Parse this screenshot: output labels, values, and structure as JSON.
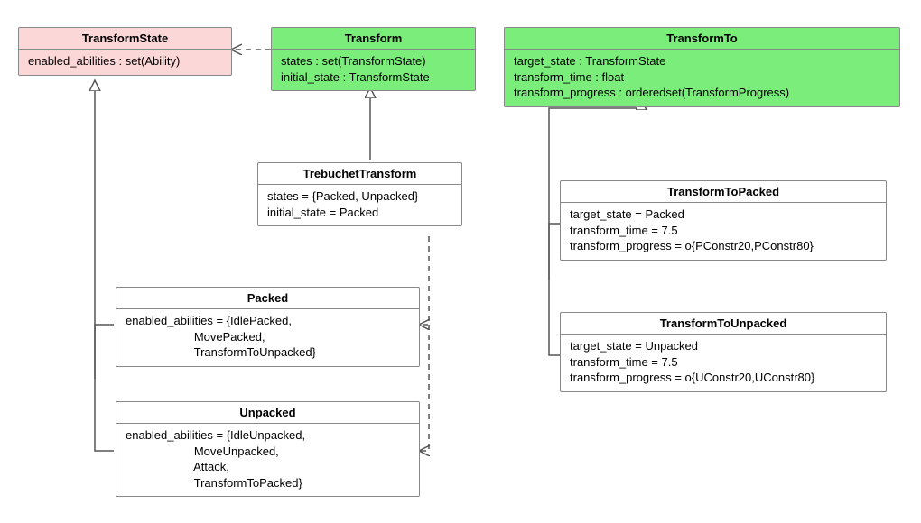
{
  "classes": {
    "transformState": {
      "title": "TransformState",
      "body": "enabled_abilities : set(Ability)"
    },
    "transform": {
      "title": "Transform",
      "body": "states : set(TransformState)\ninitial_state : TransformState"
    },
    "transformTo": {
      "title": "TransformTo",
      "body": "target_state : TransformState\ntransform_time : float\ntransform_progress : orderedset(TransformProgress)"
    },
    "trebuchetTransform": {
      "title": "TrebuchetTransform",
      "body": "states = {Packed, Unpacked}\ninitial_state = Packed"
    },
    "transformToPacked": {
      "title": "TransformToPacked",
      "body": "target_state = Packed\ntransform_time = 7.5\ntransform_progress = o{PConstr20,PConstr80}"
    },
    "transformToUnpacked": {
      "title": "TransformToUnpacked",
      "body": "target_state = Unpacked\ntransform_time = 7.5\ntransform_progress = o{UConstr20,UConstr80}"
    },
    "packed": {
      "title": "Packed",
      "body": "enabled_abilities = {IdlePacked,\n                     MovePacked,\n                     TransformToUnpacked}"
    },
    "unpacked": {
      "title": "Unpacked",
      "body": "enabled_abilities = {IdleUnpacked,\n                     MoveUnpacked,\n                     Attack,\n                     TransformToPacked}"
    }
  },
  "chart_data": {
    "type": "uml-class-diagram",
    "classes": [
      {
        "name": "TransformState",
        "stereotype": "base",
        "color": "pink",
        "attributes": [
          "enabled_abilities : set(Ability)"
        ]
      },
      {
        "name": "Transform",
        "stereotype": "base",
        "color": "green",
        "attributes": [
          "states : set(TransformState)",
          "initial_state : TransformState"
        ]
      },
      {
        "name": "TransformTo",
        "stereotype": "base",
        "color": "green",
        "attributes": [
          "target_state : TransformState",
          "transform_time : float",
          "transform_progress : orderedset(TransformProgress)"
        ]
      },
      {
        "name": "TrebuchetTransform",
        "attributes": [
          "states = {Packed, Unpacked}",
          "initial_state = Packed"
        ]
      },
      {
        "name": "TransformToPacked",
        "attributes": [
          "target_state = Packed",
          "transform_time = 7.5",
          "transform_progress = o{PConstr20,PConstr80}"
        ]
      },
      {
        "name": "TransformToUnpacked",
        "attributes": [
          "target_state = Unpacked",
          "transform_time = 7.5",
          "transform_progress = o{UConstr20,UConstr80}"
        ]
      },
      {
        "name": "Packed",
        "attributes": [
          "enabled_abilities = {IdlePacked, MovePacked, TransformToUnpacked}"
        ]
      },
      {
        "name": "Unpacked",
        "attributes": [
          "enabled_abilities = {IdleUnpacked, MoveUnpacked, Attack, TransformToPacked}"
        ]
      }
    ],
    "relations": [
      {
        "from": "TrebuchetTransform",
        "to": "Transform",
        "type": "generalization"
      },
      {
        "from": "TransformToPacked",
        "to": "TransformTo",
        "type": "generalization"
      },
      {
        "from": "TransformToUnpacked",
        "to": "TransformTo",
        "type": "generalization"
      },
      {
        "from": "Packed",
        "to": "TransformState",
        "type": "generalization"
      },
      {
        "from": "Unpacked",
        "to": "TransformState",
        "type": "generalization"
      },
      {
        "from": "Transform",
        "to": "TransformState",
        "type": "dependency"
      },
      {
        "from": "TrebuchetTransform",
        "to": "Packed",
        "type": "dependency"
      },
      {
        "from": "TrebuchetTransform",
        "to": "Unpacked",
        "type": "dependency"
      }
    ]
  }
}
